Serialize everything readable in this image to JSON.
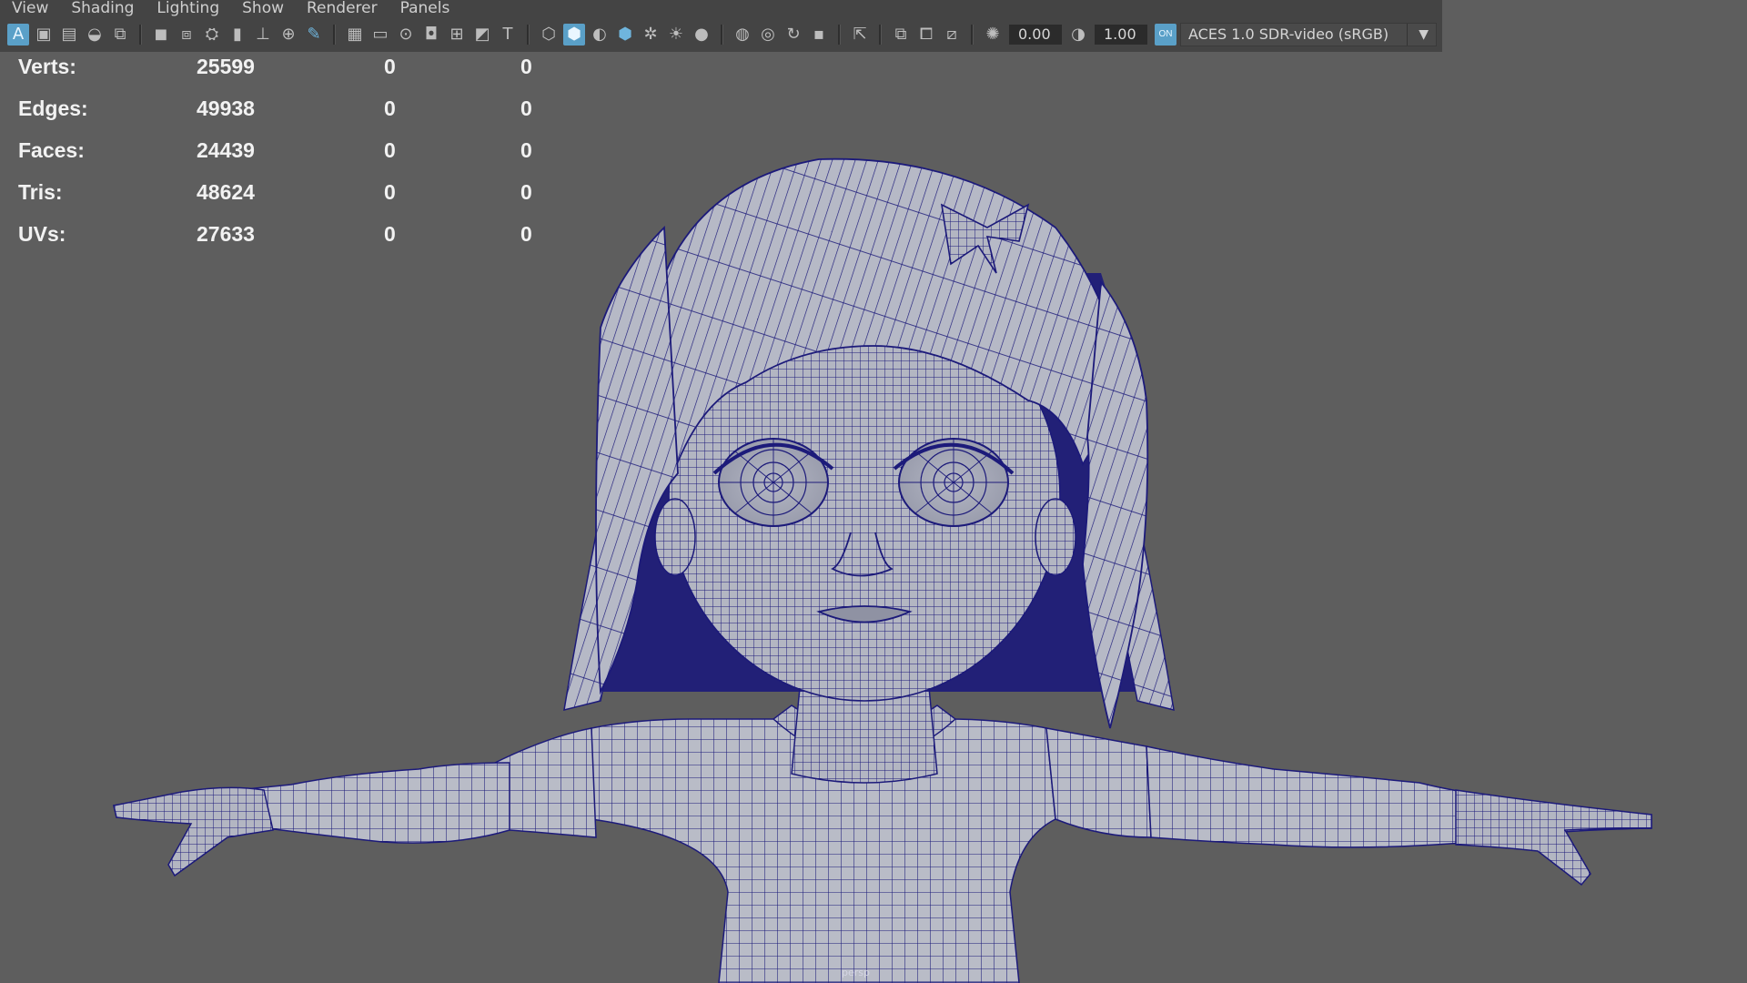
{
  "menu": [
    "View",
    "Shading",
    "Lighting",
    "Show",
    "Renderer",
    "Panels"
  ],
  "toolbar": {
    "exposure_value": "0.00",
    "gamma_value": "1.00",
    "color_space": "ACES 1.0 SDR-video (sRGB)",
    "icons": [
      "select-camera-icon",
      "camera-attributes-icon",
      "bookmarks-icon",
      "image-plane-icon",
      "2d-pan-zoom-icon",
      "grease-pencil-icon",
      "grid-icon",
      "film-gate-icon",
      "resolution-gate-icon",
      "gate-mask-icon",
      "field-chart-icon",
      "safe-action-icon",
      "safe-title-icon",
      "wireframe-icon",
      "smooth-shade-icon",
      "use-default-material-icon",
      "wireframe-on-shaded-icon",
      "xray-icon",
      "use-all-lights-icon",
      "shadows-icon",
      "ambient-occlusion-icon",
      "motion-blur-icon",
      "anti-aliasing-icon",
      "depth-of-field-icon",
      "isolate-select-icon",
      "xray-joints-icon",
      "xray-active-icon",
      "backface-culling-icon",
      "exposure-icon",
      "gamma-icon",
      "color-management-icon"
    ]
  },
  "hud": {
    "rows": [
      {
        "label": "Verts:",
        "v1": "25599",
        "v2": "0",
        "v3": "0"
      },
      {
        "label": "Edges:",
        "v1": "49938",
        "v2": "0",
        "v3": "0"
      },
      {
        "label": "Faces:",
        "v1": "24439",
        "v2": "0",
        "v3": "0"
      },
      {
        "label": "Tris:",
        "v1": "48624",
        "v2": "0",
        "v3": "0"
      },
      {
        "label": "UVs:",
        "v1": "27633",
        "v2": "0",
        "v3": "0"
      }
    ]
  },
  "viewport": {
    "camera_label": "persp",
    "wire_color": "#1c1a7a",
    "surface_color": "#b9bcc7"
  }
}
